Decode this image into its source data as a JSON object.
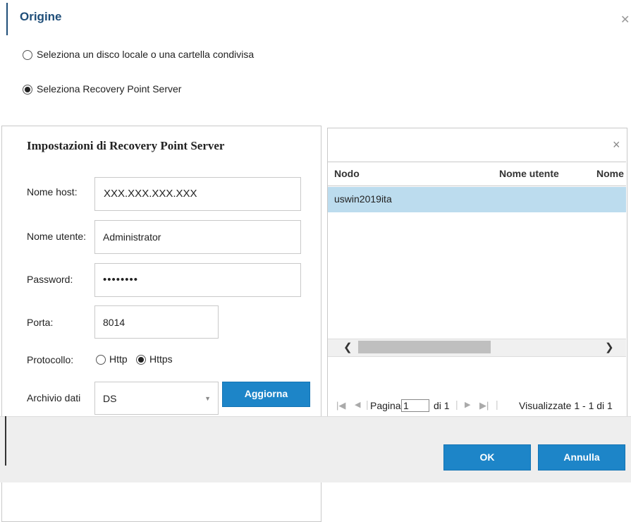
{
  "dialog": {
    "title": "Origine"
  },
  "source": {
    "option_local": "Seleziona un disco locale o una cartella condivisa",
    "option_rps": "Seleziona Recovery Point Server"
  },
  "rps": {
    "title": "Impostazioni di Recovery Point Server",
    "host_label": "Nome host:",
    "host_value": "XXX.XXX.XXX.XXX",
    "user_label": "Nome utente:",
    "user_value": "Administrator",
    "password_label": "Password:",
    "password_value": "••••••••",
    "port_label": "Porta:",
    "port_value": "8014",
    "protocol_label": "Protocollo:",
    "protocol_http": "Http",
    "protocol_https": "Https",
    "datastore_label": "Archivio dati",
    "datastore_value": "DS",
    "refresh_button": "Aggiorna"
  },
  "grid": {
    "search_clear": "×",
    "columns": [
      "Nodo",
      "Nome utente",
      "Nome"
    ],
    "rows": [
      {
        "nodo": "uswin2019ita"
      }
    ],
    "scroll_left": "❮",
    "scroll_right": "❯",
    "pager": {
      "page_label": "Pagina",
      "page_value": "1",
      "of_label": "di 1",
      "summary": "Visualizzate 1 - 1 di 1"
    }
  },
  "footer": {
    "ok_button": "OK",
    "cancel_button": "Annulla"
  },
  "colors": {
    "accent": "#1d85c8",
    "title": "#1f4e79",
    "selected_row": "#bcdcee"
  }
}
